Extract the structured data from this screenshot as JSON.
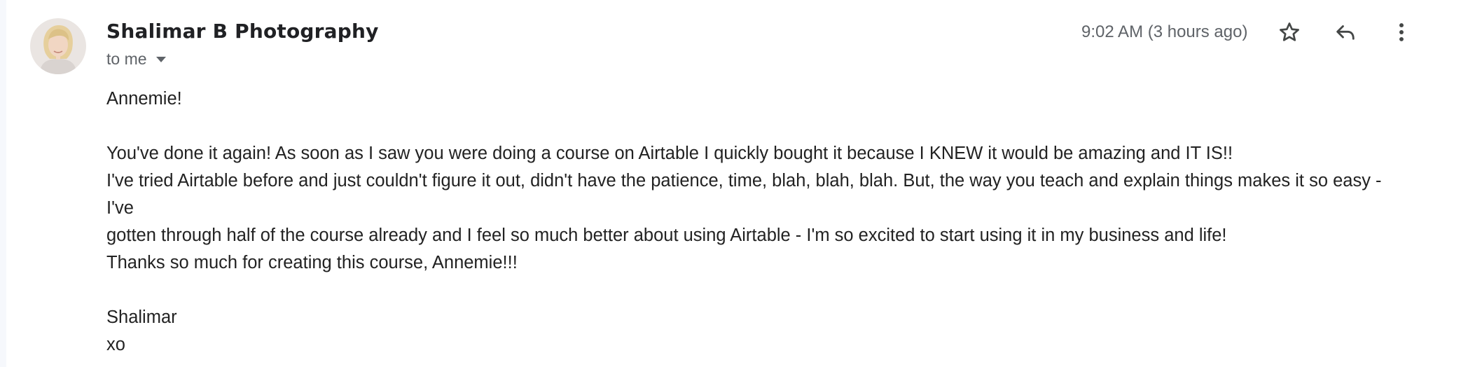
{
  "message": {
    "sender_name": "Shalimar B Photography",
    "recipient_label": "to me",
    "timestamp": "9:02 AM (3 hours ago)",
    "icons": {
      "avatar": "sender-avatar",
      "recipient_dropdown": "caret-down-icon",
      "star": "star-outline-icon",
      "reply": "reply-icon",
      "more": "more-vertical-icon"
    },
    "body": {
      "line1": "Annemie!",
      "line2": "You've done it again! As soon as I saw you were doing a course on Airtable I quickly bought it because I KNEW it would be amazing and IT IS!!",
      "line3": "I've tried Airtable before and just couldn't figure it out, didn't have the patience, time, blah, blah, blah. But, the way you teach and explain things makes it so easy -",
      "line4": "I've",
      "line5": "gotten through half of the course already and I feel so much better about using Airtable - I'm so excited to start using it in my business and life!",
      "line6": "Thanks so much for creating this course, Annemie!!!",
      "line7": "Shalimar",
      "line8": "xo"
    }
  },
  "colors": {
    "text_primary": "#202124",
    "text_secondary": "#5f6368",
    "body_text": "#222222",
    "left_edge": "#f6f8fc"
  }
}
